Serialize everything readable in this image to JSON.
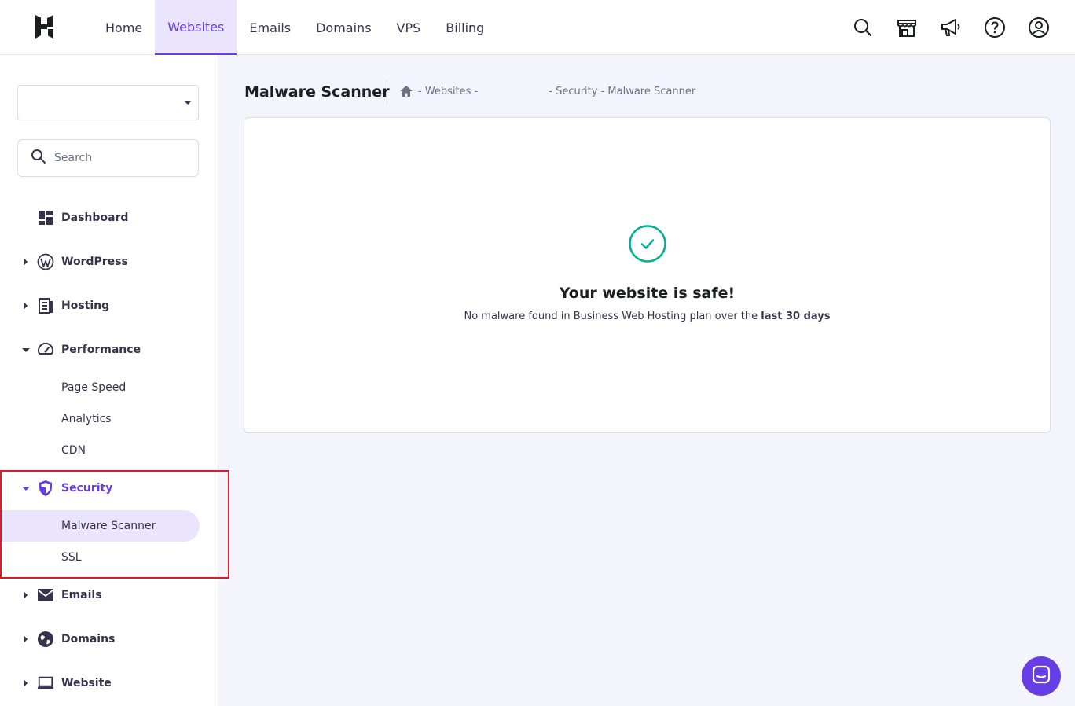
{
  "nav": {
    "items": [
      {
        "label": "Home",
        "active": false
      },
      {
        "label": "Websites",
        "active": true
      },
      {
        "label": "Emails",
        "active": false
      },
      {
        "label": "Domains",
        "active": false
      },
      {
        "label": "VPS",
        "active": false
      },
      {
        "label": "Billing",
        "active": false
      }
    ]
  },
  "top_icons": [
    "search-icon",
    "store-icon",
    "megaphone-icon",
    "help-icon",
    "account-icon"
  ],
  "sidebar": {
    "select_value": "",
    "search_placeholder": "Search",
    "items": [
      {
        "label": "Dashboard",
        "icon": "dashboard-icon"
      },
      {
        "label": "WordPress",
        "icon": "wordpress-icon"
      },
      {
        "label": "Hosting",
        "icon": "hosting-icon"
      },
      {
        "label": "Performance",
        "icon": "gauge-icon",
        "expanded": true
      },
      {
        "label": "Security",
        "icon": "shield-icon",
        "expanded": true
      },
      {
        "label": "Emails",
        "icon": "mail-icon"
      },
      {
        "label": "Domains",
        "icon": "globe-icon"
      },
      {
        "label": "Website",
        "icon": "laptop-icon"
      }
    ],
    "performance_sub": [
      "Page Speed",
      "Analytics",
      "CDN"
    ],
    "security_sub": [
      "Malware Scanner",
      "SSL"
    ]
  },
  "main": {
    "title": "Malware Scanner",
    "breadcrumb": {
      "websites": "- Websites -",
      "rest": "- Security - Malware Scanner"
    },
    "status_title": "Your website is safe!",
    "status_desc_prefix": "No malware found in Business Web Hosting plan over the",
    "status_desc_bold": "last 30 days"
  },
  "colors": {
    "accent": "#673de6",
    "success": "#00b090",
    "highlight": "#d4202a"
  }
}
